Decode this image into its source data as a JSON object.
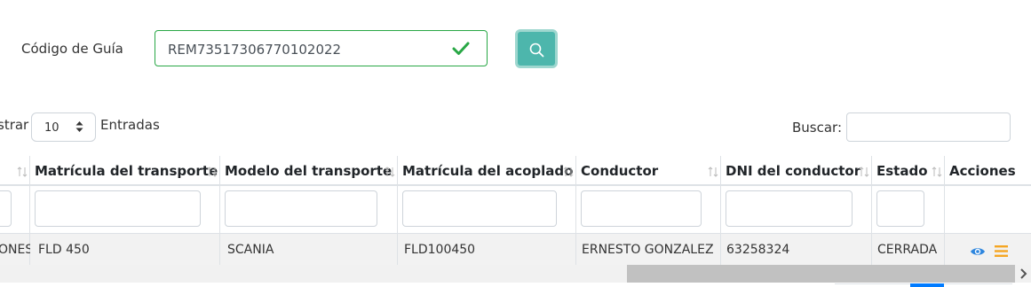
{
  "guide_search": {
    "label": "Código de Guía",
    "value": "REM73517306770102022",
    "valid_color": "#28a745",
    "button_icon": "search-icon",
    "button_color": "#4db6ac"
  },
  "length_menu": {
    "prefix": "strar",
    "selected": "10",
    "suffix": "Entradas"
  },
  "filter": {
    "label": "Buscar:",
    "value": ""
  },
  "table": {
    "columns": [
      {
        "label": "",
        "sortable": true
      },
      {
        "label": "Matrícula del transporte",
        "sortable": true
      },
      {
        "label": "Modelo del transporte",
        "sortable": true
      },
      {
        "label": "Matrícula del acoplado",
        "sortable": true
      },
      {
        "label": "Conductor",
        "sortable": true
      },
      {
        "label": "DNI del conductor",
        "sortable": true
      },
      {
        "label": "Estado",
        "sortable": true
      },
      {
        "label": "Acciones",
        "sortable": false
      }
    ],
    "rows": [
      {
        "cells": [
          "ONES",
          "FLD 450",
          "SCANIA",
          "FLD100450",
          "ERNESTO GONZALEZ",
          "63258324",
          "CERRADA"
        ],
        "actions": [
          "eye-icon",
          "menu-icon"
        ]
      }
    ]
  },
  "colors": {
    "action_view": "#2e86de",
    "action_menu": "#f5a623",
    "pager_active": "#007bff"
  }
}
